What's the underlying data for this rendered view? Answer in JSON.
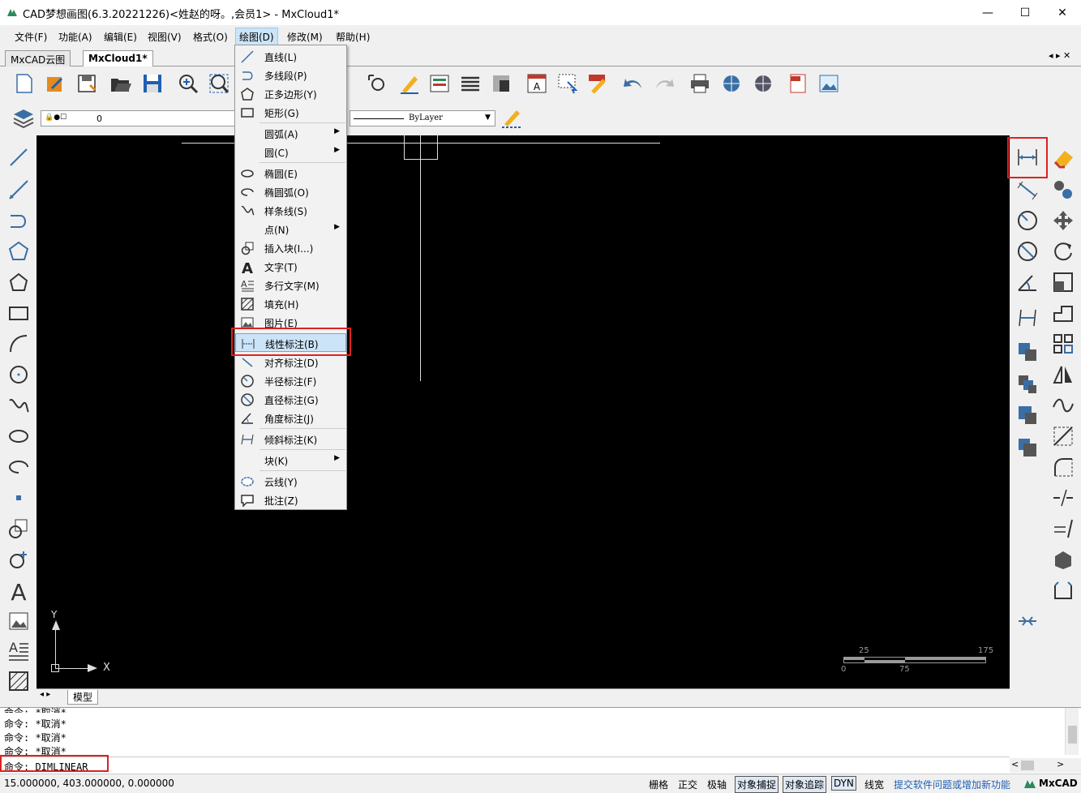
{
  "window": {
    "title": "CAD梦想画图(6.3.20221226)<姓赵的呀。,会员1> - MxCloud1*",
    "minimize": "—",
    "maximize": "☐",
    "close": "✕"
  },
  "menubar": [
    "文件(F)",
    "功能(A)",
    "编辑(E)",
    "视图(V)",
    "格式(O)",
    "绘图(D)",
    "修改(M)",
    "帮助(H)"
  ],
  "tabs": [
    "MxCAD云图",
    "MxCloud1*"
  ],
  "tab_nav": "◂ ▸ ✕",
  "layer": {
    "name": "0",
    "linetype": "ByLayer"
  },
  "draw_menu": [
    {
      "label": "直线(L)",
      "icon": "line-icon"
    },
    {
      "label": "多线段(P)",
      "icon": "polyline-icon"
    },
    {
      "label": "正多边形(Y)",
      "icon": "polygon-icon"
    },
    {
      "label": "矩形(G)",
      "icon": "rectangle-icon"
    },
    {
      "label": "圆弧(A)",
      "icon": "",
      "sub": true
    },
    {
      "label": "圆(C)",
      "icon": "",
      "sub": true
    },
    {
      "label": "椭圆(E)",
      "icon": "ellipse-icon"
    },
    {
      "label": "椭圆弧(O)",
      "icon": "ellipse-arc-icon"
    },
    {
      "label": "样条线(S)",
      "icon": "spline-icon"
    },
    {
      "label": "点(N)",
      "icon": "",
      "sub": true
    },
    {
      "label": "插入块(I...)",
      "icon": "insert-block-icon"
    },
    {
      "label": "文字(T)",
      "icon": "text-icon"
    },
    {
      "label": "多行文字(M)",
      "icon": "mtext-icon"
    },
    {
      "label": "填充(H)",
      "icon": "hatch-icon"
    },
    {
      "label": "图片(E)",
      "icon": "image-icon"
    },
    {
      "label": "线性标注(B)",
      "icon": "dim-linear-icon"
    },
    {
      "label": "对齐标注(D)",
      "icon": "dim-aligned-icon"
    },
    {
      "label": "半径标注(F)",
      "icon": "dim-radius-icon"
    },
    {
      "label": "直径标注(G)",
      "icon": "dim-diameter-icon"
    },
    {
      "label": "角度标注(J)",
      "icon": "dim-angle-icon"
    },
    {
      "label": "倾斜标注(K)",
      "icon": "dim-oblique-icon"
    },
    {
      "label": "块(K)",
      "icon": "",
      "sub": true
    },
    {
      "label": "云线(Y)",
      "icon": "revcloud-icon"
    },
    {
      "label": "批注(Z)",
      "icon": "comment-icon"
    }
  ],
  "canvas": {
    "ucs_x": "X",
    "ucs_y": "Y",
    "scale_labels": [
      "25",
      "175",
      "0",
      "75"
    ],
    "model_tab": "模型"
  },
  "command": {
    "history": [
      "命令:  *取消*",
      "命令:  *取消*",
      "命令:  *取消*",
      "命令:  *取消*"
    ],
    "current": "命令: DIMLINEAR"
  },
  "status": {
    "coords": "15.000000,  403.000000,  0.000000",
    "toggles": [
      {
        "label": "栅格",
        "on": false
      },
      {
        "label": "正交",
        "on": false
      },
      {
        "label": "极轴",
        "on": false
      },
      {
        "label": "对象捕捉",
        "on": true
      },
      {
        "label": "对象追踪",
        "on": true
      },
      {
        "label": "DYN",
        "on": true
      },
      {
        "label": "线宽",
        "on": false
      }
    ],
    "feedback_link": "提交软件问题或增加新功能",
    "brand": "MxCAD"
  },
  "colors": {
    "accent": "#1e5fb4",
    "highlight": "#e02020",
    "canvas": "#000000"
  }
}
